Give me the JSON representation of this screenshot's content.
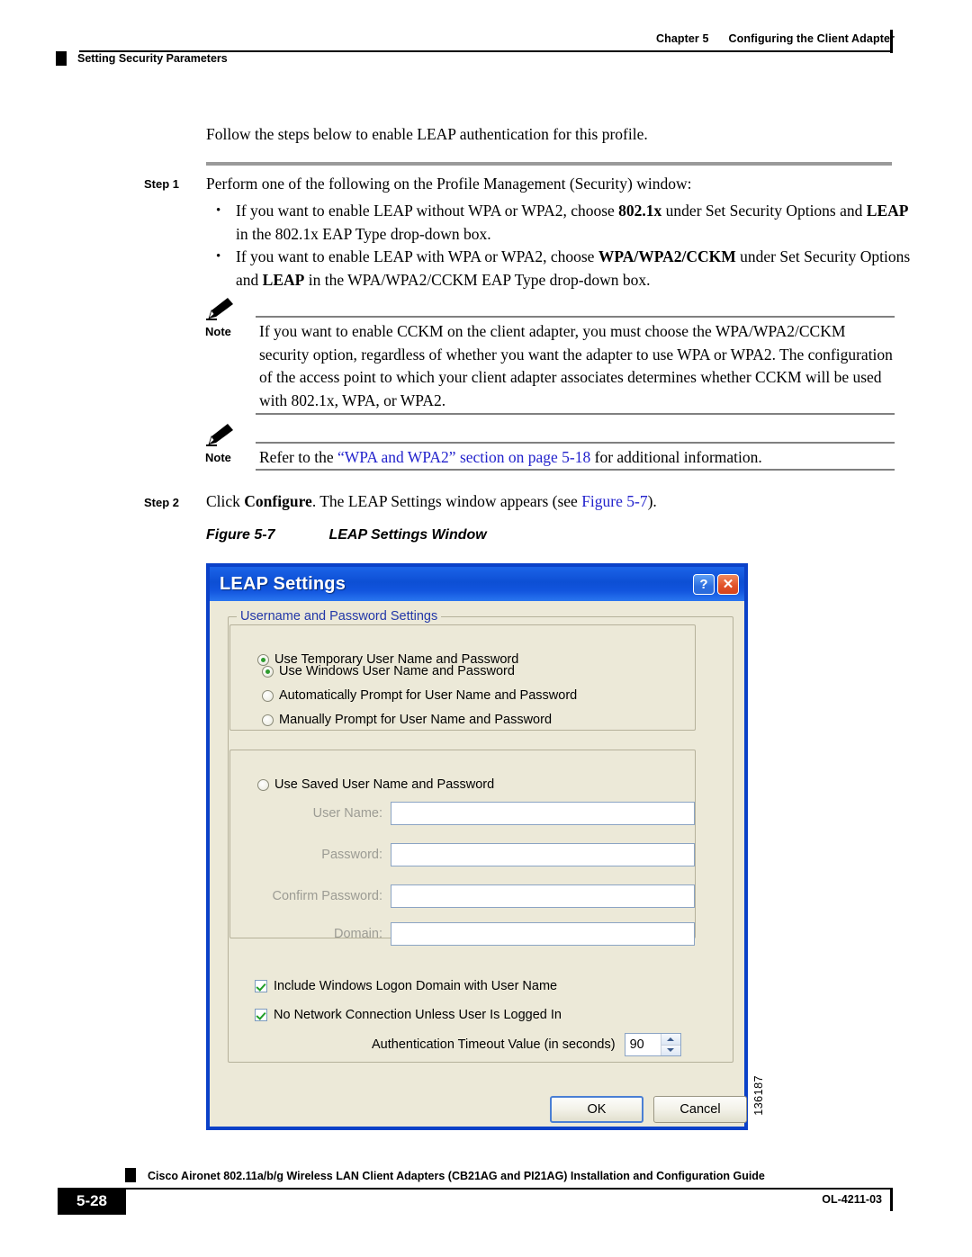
{
  "header": {
    "chapter_number": "Chapter 5",
    "chapter_title": "Configuring the Client Adapter",
    "section_title": "Setting Security Parameters"
  },
  "body": {
    "intro": "Follow the steps below to enable LEAP authentication for this profile.",
    "step1": {
      "label": "Step 1",
      "text": "Perform one of the following on the Profile Management (Security) window:",
      "bullets": [
        {
          "prefix": "If you want to enable LEAP without WPA or WPA2, choose ",
          "bold1": "802.1x",
          "mid": " under Set Security Options and ",
          "bold2": "LEAP",
          "suffix": " in the 802.1x EAP Type drop-down box."
        },
        {
          "prefix": "If you want to enable LEAP with WPA or WPA2, choose ",
          "bold1": "WPA/WPA2/CCKM",
          "mid": " under Set Security Options and ",
          "bold2": "LEAP",
          "suffix": " in the WPA/WPA2/CCKM EAP Type drop-down box."
        }
      ]
    },
    "note1": {
      "label": "Note",
      "text": "If you want to enable CCKM on the client adapter, you must choose the WPA/WPA2/CCKM security option, regardless of whether you want the adapter to use WPA or WPA2. The configuration of the access point to which your client adapter associates determines whether CCKM will be used with 802.1x, WPA, or WPA2."
    },
    "note2": {
      "label": "Note",
      "text_prefix": "Refer to the ",
      "link_text": "“WPA and WPA2” section on page 5-18",
      "text_suffix": " for additional information."
    },
    "step2": {
      "label": "Step 2",
      "prefix": "Click ",
      "bold": "Configure",
      "mid": ". The LEAP Settings window appears (see ",
      "link": "Figure 5-7",
      "suffix": ")."
    },
    "figure_caption": {
      "number": "Figure 5-7",
      "title": "LEAP Settings Window"
    },
    "figure_id": "136187"
  },
  "dialog": {
    "title": "LEAP Settings",
    "help_button": "?",
    "close_button": "✕",
    "group_username_password": "Username and Password Settings",
    "radios": [
      {
        "id": "temporary",
        "label": "Use Temporary User Name and Password",
        "checked": true
      },
      {
        "id": "windows",
        "label": "Use Windows User Name and Password",
        "checked": true
      },
      {
        "id": "auto-prompt",
        "label": "Automatically Prompt for User Name and Password",
        "checked": false
      },
      {
        "id": "manual-prompt",
        "label": "Manually Prompt for User Name and Password",
        "checked": false
      },
      {
        "id": "saved",
        "label": "Use Saved User Name and Password",
        "checked": false
      }
    ],
    "fields": [
      {
        "id": "user-name",
        "label": "User Name:",
        "value": "",
        "enabled": false
      },
      {
        "id": "password",
        "label": "Password:",
        "value": "",
        "enabled": false
      },
      {
        "id": "confirm-password",
        "label": "Confirm Password:",
        "value": "",
        "enabled": false
      },
      {
        "id": "domain",
        "label": "Domain:",
        "value": "",
        "enabled": false
      }
    ],
    "checkboxes": [
      {
        "id": "include-domain",
        "label": "Include Windows Logon Domain with User Name",
        "checked": true
      },
      {
        "id": "no-network",
        "label": "No Network Connection Unless User Is Logged In",
        "checked": true
      }
    ],
    "timeout": {
      "label": "Authentication Timeout Value (in seconds)",
      "value": "90"
    },
    "buttons": {
      "ok": "OK",
      "cancel": "Cancel"
    },
    "colors": {
      "titlebar": "#0d4fd4",
      "dialog_border": "#0B41C8",
      "face": "#ECE9D8",
      "group_label": "#2237a8",
      "close_button": "#d5431c"
    }
  },
  "footer": {
    "page_number": "5-28",
    "book_title": "Cisco Aironet 802.11a/b/g Wireless LAN Client Adapters (CB21AG and PI21AG) Installation and Configuration Guide",
    "doc_id": "OL-4211-03"
  }
}
